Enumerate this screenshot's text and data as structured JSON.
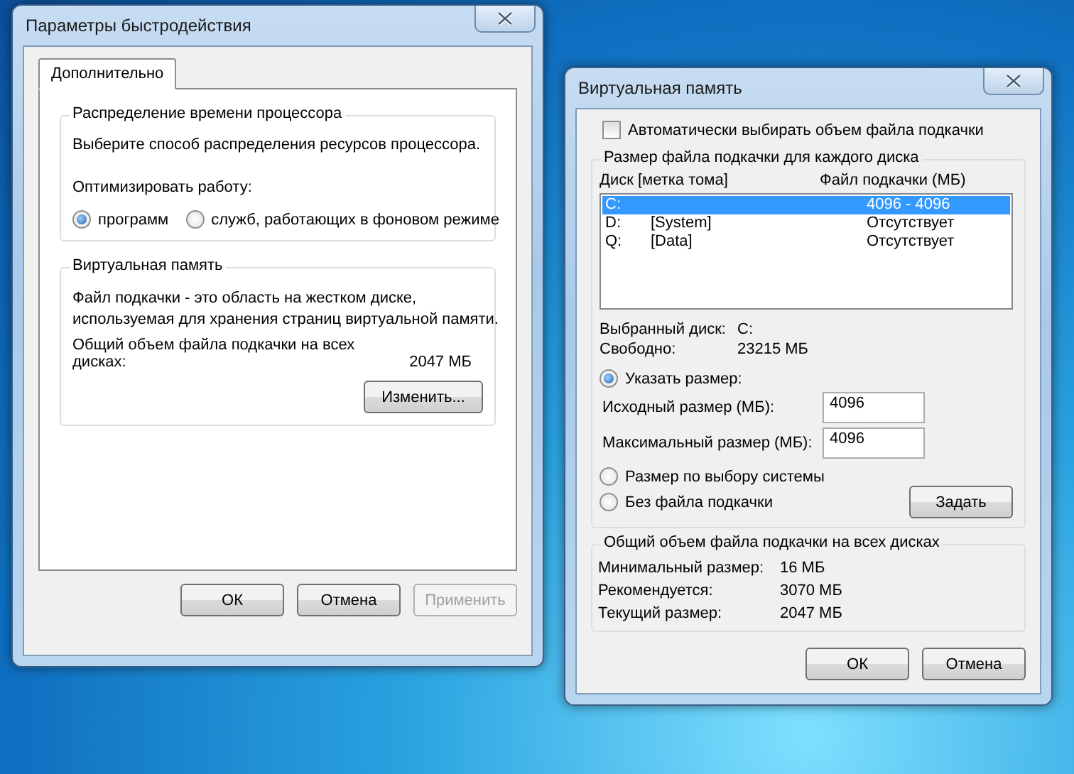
{
  "performance_dialog": {
    "title": "Параметры быстродействия",
    "tabs": [
      {
        "label": "Дополнительно",
        "selected": true
      }
    ],
    "processor_group": {
      "title": "Распределение времени процессора",
      "description": "Выберите способ распределения ресурсов процессора.",
      "optimize_label": "Оптимизировать работу:",
      "options": [
        {
          "label": "программ",
          "selected": true
        },
        {
          "label": "служб, работающих в фоновом режиме",
          "selected": false
        }
      ]
    },
    "virtual_memory_group": {
      "title": "Виртуальная память",
      "description": "Файл подкачки - это область на жестком диске, используемая для хранения страниц виртуальной памяти.",
      "total_label": "Общий объем файла подкачки на всех дисках:",
      "total_value": "2047 МБ",
      "change_button": "Изменить..."
    },
    "buttons": [
      {
        "label": "ОК",
        "disabled": false
      },
      {
        "label": "Отмена",
        "disabled": false
      },
      {
        "label": "Применить",
        "disabled": true
      }
    ]
  },
  "virtual_memory_dialog": {
    "title": "Виртуальная память",
    "auto_manage": {
      "label": "Автоматически выбирать объем файла подкачки",
      "checked": false
    },
    "drives_group": {
      "title": "Размер файла подкачки для каждого диска",
      "columns": [
        "Диск [метка тома]",
        "Файл подкачки (МБ)"
      ],
      "rows": [
        {
          "drive": "C:",
          "size": "4096 - 4096",
          "selected": true
        },
        {
          "drive": "D:",
          "label": "[System]",
          "size": "Отсутствует",
          "selected": false
        },
        {
          "drive": "Q:",
          "label": "[Data]",
          "size": "Отсутствует",
          "selected": false
        }
      ],
      "selected_drive_label": "Выбранный диск:",
      "selected_drive": "C:",
      "free_label": "Свободно:",
      "free_value": "23215 МБ",
      "size_options": [
        {
          "label": "Указать размер:",
          "selected": true
        },
        {
          "label": "Размер по выбору системы",
          "selected": false
        },
        {
          "label": "Без файла подкачки",
          "selected": false
        }
      ],
      "initial_size": {
        "label": "Исходный размер (МБ):",
        "value": "4096"
      },
      "maximum_size": {
        "label": "Максимальный размер (МБ):",
        "value": "4096"
      },
      "set_button": "Задать"
    },
    "totals_group": {
      "title": "Общий объем файла подкачки на всех дисках",
      "rows": [
        {
          "label": "Минимальный размер:",
          "value": "16 МБ"
        },
        {
          "label": "Рекомендуется:",
          "value": "3070 МБ"
        },
        {
          "label": "Текущий размер:",
          "value": "2047 МБ"
        }
      ]
    },
    "buttons": [
      {
        "label": "ОК",
        "disabled": false
      },
      {
        "label": "Отмена",
        "disabled": false
      }
    ]
  }
}
